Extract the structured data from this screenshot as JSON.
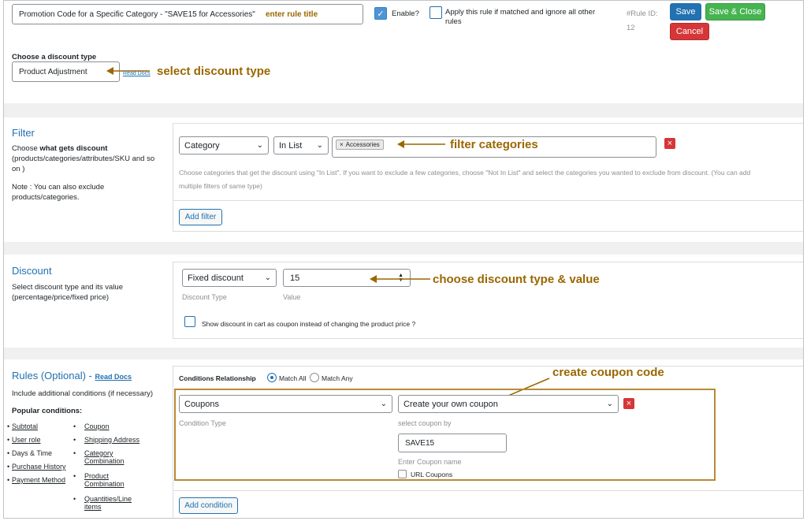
{
  "header": {
    "rule_title_value": "Promotion Code for a Specific Category - \"SAVE15 for Accessories\"",
    "enable_label": "Enable?",
    "apply_label_line1": "Apply this rule if matched and ignore all other",
    "apply_label_line2": "rules",
    "rule_id_label": "#Rule ID:",
    "rule_id_value": "12",
    "save_label": "Save",
    "save_close_label": "Save & Close",
    "cancel_label": "Cancel",
    "discount_type_heading": "Choose a discount type",
    "discount_type_value": "Product Adjustment",
    "read_docs_label": "Read Docs"
  },
  "filter": {
    "title": "Filter",
    "desc_pre": "Choose ",
    "desc_bold": "what gets discount",
    "desc_line2": "(products/categories/attributes/SKU and so",
    "desc_line3": "on )",
    "note_line1": "Note : You can also exclude",
    "note_line2": "products/categories.",
    "type_value": "Category",
    "operator_value": "In List",
    "tag_value": "Accessories",
    "help_line1": "Choose categories that get the discount using \"In List\". If you want to exclude a few categories, choose \"Not In List\" and select the categories you wanted to exclude from discount. (You can add",
    "help_line2": "multiple filters of same type)",
    "add_filter_label": "Add filter"
  },
  "discount": {
    "title": "Discount",
    "desc_line1": "Select discount type and its value",
    "desc_line2": "(percentage/price/fixed price)",
    "type_value": "Fixed discount",
    "value": "15",
    "type_caption": "Discount Type",
    "value_caption": "Value",
    "coupon_label": "Show discount in cart as coupon instead of changing the product price ?"
  },
  "rules": {
    "title": "Rules (Optional) -",
    "read_docs_label": "Read Docs",
    "desc": "Include additional conditions (if necessary)",
    "popular_heading": "Popular conditions:",
    "popular_left": [
      "Subtotal",
      "User role",
      "Days & Time",
      "Purchase History",
      "Payment Method"
    ],
    "popular_right": [
      {
        "line1": "Coupon",
        "line2": ""
      },
      {
        "line1": "Shipping Address",
        "line2": ""
      },
      {
        "line1": "Category",
        "line2": "Combination"
      },
      {
        "line1": "Product",
        "line2": "Combination"
      },
      {
        "line1": "Quantities/Line",
        "line2": "items"
      }
    ],
    "relationship_label": "Conditions Relationship",
    "match_all_label": "Match All",
    "match_any_label": "Match Any",
    "condition_type_value": "Coupons",
    "condition_type_caption": "Condition Type",
    "coupon_mode_value": "Create your own coupon",
    "coupon_mode_caption": "select coupon by",
    "coupon_name_value": "SAVE15",
    "coupon_name_caption": "Enter Coupon name",
    "url_coupons_label": "URL Coupons",
    "add_condition_label": "Add condition"
  },
  "annotations": {
    "rule_title": "enter rule title",
    "discount_type": "select discount type",
    "filter_categories": "filter categories",
    "discount_value": "choose discount type & value",
    "coupon_code": "create coupon code",
    "color": "#9a6700"
  }
}
